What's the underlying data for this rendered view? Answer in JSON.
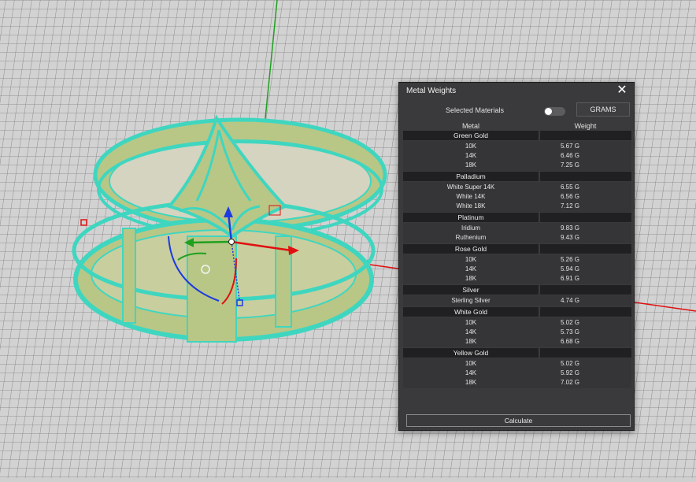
{
  "viewport": {
    "grid_color": "#7a7a7a",
    "background_color": "#d2d2d2",
    "model_color": "#3fd6c0",
    "model_fill_color": "#b8c786",
    "axis_colors": {
      "x": "#e01010",
      "y": "#1fa01f",
      "z": "#1d3be0"
    }
  },
  "panel": {
    "title": "Metal Weights",
    "close_symbol": "✕",
    "selected_materials_label": "Selected Materials",
    "selected_materials_enabled": false,
    "unit_button_label": "GRAMS",
    "columns": {
      "metal": "Metal",
      "weight": "Weight"
    },
    "groups": [
      {
        "name": "Green Gold",
        "rows": [
          {
            "name": "10K",
            "weight": "5.67 G"
          },
          {
            "name": "14K",
            "weight": "6.46 G"
          },
          {
            "name": "18K",
            "weight": "7.25 G"
          }
        ]
      },
      {
        "name": "Palladium",
        "rows": [
          {
            "name": "White Super 14K",
            "weight": "6.55 G"
          },
          {
            "name": "White 14K",
            "weight": "6.56 G"
          },
          {
            "name": "White 18K",
            "weight": "7.12 G"
          }
        ]
      },
      {
        "name": "Platinum",
        "rows": [
          {
            "name": "Iridium",
            "weight": "9.83 G"
          },
          {
            "name": "Ruthenium",
            "weight": "9.43 G"
          }
        ]
      },
      {
        "name": "Rose Gold",
        "rows": [
          {
            "name": "10K",
            "weight": "5.26 G"
          },
          {
            "name": "14K",
            "weight": "5.94 G"
          },
          {
            "name": "18K",
            "weight": "6.91 G"
          }
        ]
      },
      {
        "name": "Silver",
        "rows": [
          {
            "name": "Sterling Silver",
            "weight": "4.74 G"
          }
        ]
      },
      {
        "name": "White Gold",
        "rows": [
          {
            "name": "10K",
            "weight": "5.02 G"
          },
          {
            "name": "14K",
            "weight": "5.73 G"
          },
          {
            "name": "18K",
            "weight": "6.68 G"
          }
        ]
      },
      {
        "name": "Yellow Gold",
        "rows": [
          {
            "name": "10K",
            "weight": "5.02 G"
          },
          {
            "name": "14K",
            "weight": "5.92 G"
          },
          {
            "name": "18K",
            "weight": "7.02 G"
          }
        ]
      }
    ],
    "calculate_label": "Calculate"
  }
}
